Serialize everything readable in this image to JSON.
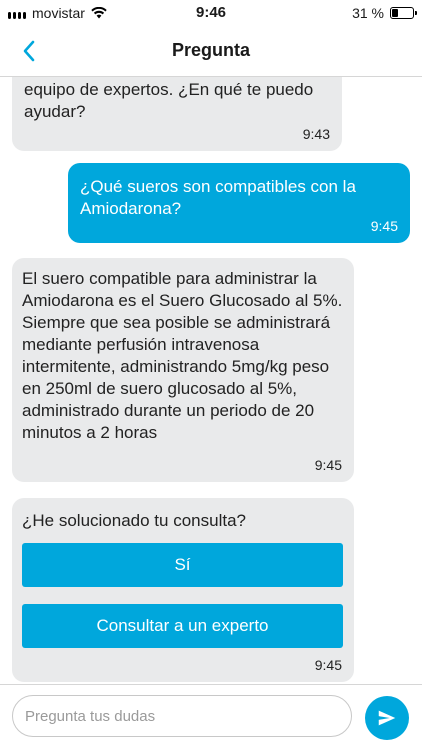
{
  "status_bar": {
    "carrier": "movistar",
    "time": "9:46",
    "battery": "31 %",
    "battery_level": 0.31
  },
  "nav": {
    "title": "Pregunta"
  },
  "messages": [
    {
      "direction": "in",
      "text": "equipo de expertos. ¿En qué te puedo ayudar?",
      "time": "9:43"
    },
    {
      "direction": "out",
      "text": "¿Qué sueros son compatibles con la Amiodarona?",
      "time": "9:45"
    },
    {
      "direction": "in",
      "text": "El suero compatible para administrar la Amiodarona es el Suero Glucosado al 5%. Siempre que sea posible se administrará mediante perfusión intravenosa intermitente, administrando 5mg/kg peso en 250ml de suero glucosado al 5%, administrado durante un periodo de 20 minutos a 2 horas",
      "time": "9:45"
    }
  ],
  "feedback": {
    "question": "¿He solucionado tu consulta?",
    "yes_label": "Sí",
    "expert_label": "Consultar a un experto",
    "time": "9:45"
  },
  "composer": {
    "placeholder": "Pregunta tus dudas",
    "value": ""
  },
  "colors": {
    "accent": "#00a7dc",
    "incoming": "#e9eaeb"
  }
}
